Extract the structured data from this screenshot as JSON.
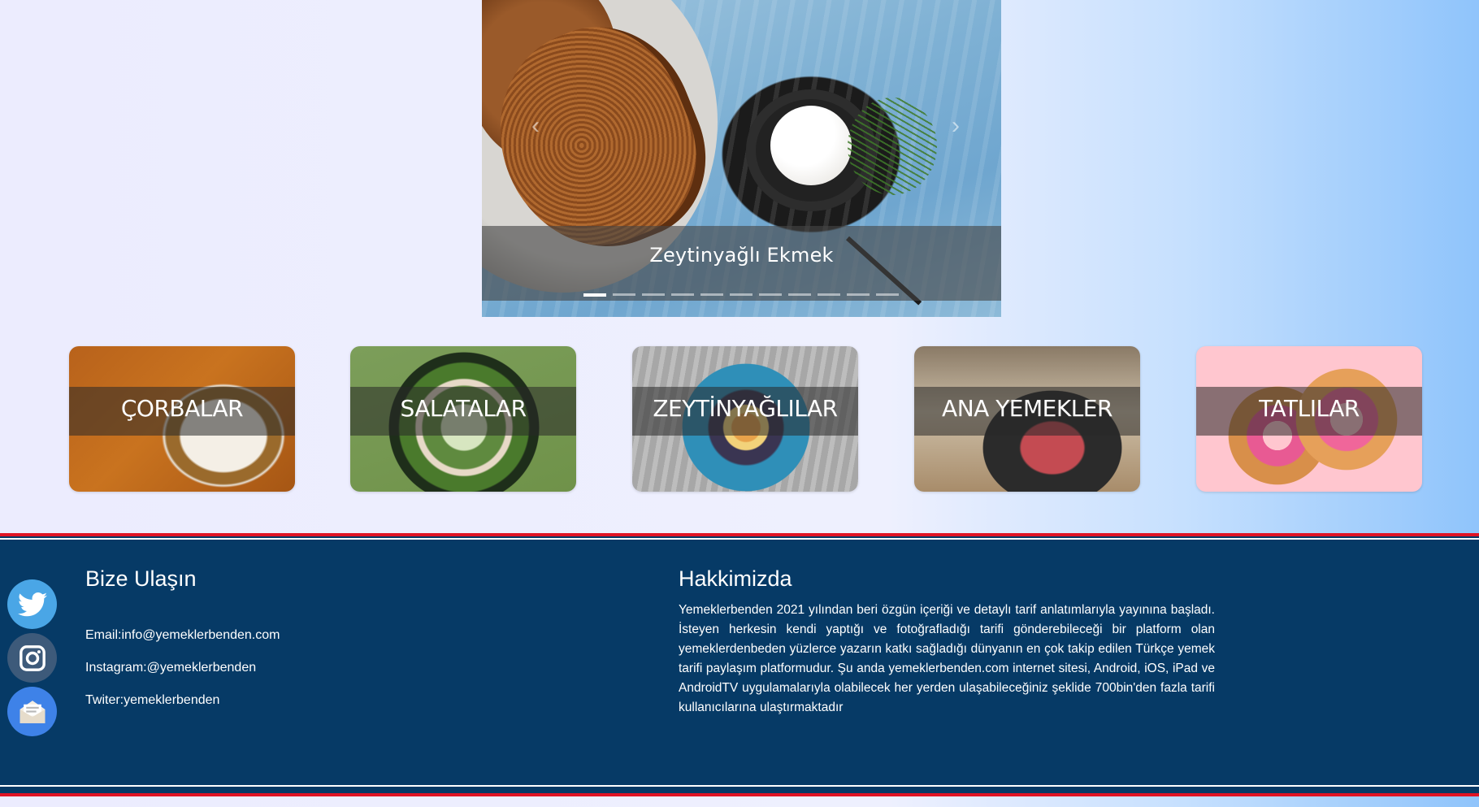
{
  "carousel": {
    "caption": "Zeytinyağlı Ekmek",
    "slide_count": 11,
    "active_index": 0,
    "prev_icon": "chevron-left-icon",
    "next_icon": "chevron-right-icon"
  },
  "categories": [
    {
      "label": "ÇORBALAR"
    },
    {
      "label": "SALATALAR"
    },
    {
      "label": "ZEYTİNYAĞLILAR"
    },
    {
      "label": "ANA YEMEKLER"
    },
    {
      "label": "TATLILAR"
    }
  ],
  "footer": {
    "accent_color": "#e01324",
    "background_color": "#063a66",
    "social": [
      {
        "name": "twitter-icon",
        "color": "#4aa6e6"
      },
      {
        "name": "instagram-icon",
        "color": "#3d5a7a"
      },
      {
        "name": "mail-icon",
        "color": "#3e82e8"
      }
    ],
    "contact": {
      "title": "Bize Ulaşın",
      "email": "Email:info@yemeklerbenden.com",
      "instagram": "Instagram:@yemeklerbenden",
      "twitter": "Twiter:yemeklerbenden"
    },
    "about": {
      "title": "Hakkimizda",
      "text": "Yemeklerbenden 2021 yılından beri özgün içeriği ve detaylı tarif anlatımlarıyla yayınına başladı. İsteyen herkesin kendi yaptığı ve fotoğrafladığı tarifi gönderebileceği bir platform olan yemeklerdenbeden yüzlerce yazarın katkı sağladığı dünyanın en çok takip edilen Türkçe yemek tarifi paylaşım platformudur. Şu anda yemeklerbenden.com internet sitesi, Android, iOS, iPad ve AndroidTV uygulamalarıyla olabilecek her yerden ulaşabileceğiniz şeklide 700bin'den fazla tarifi kullanıcılarına ulaştırmaktadır"
    }
  }
}
